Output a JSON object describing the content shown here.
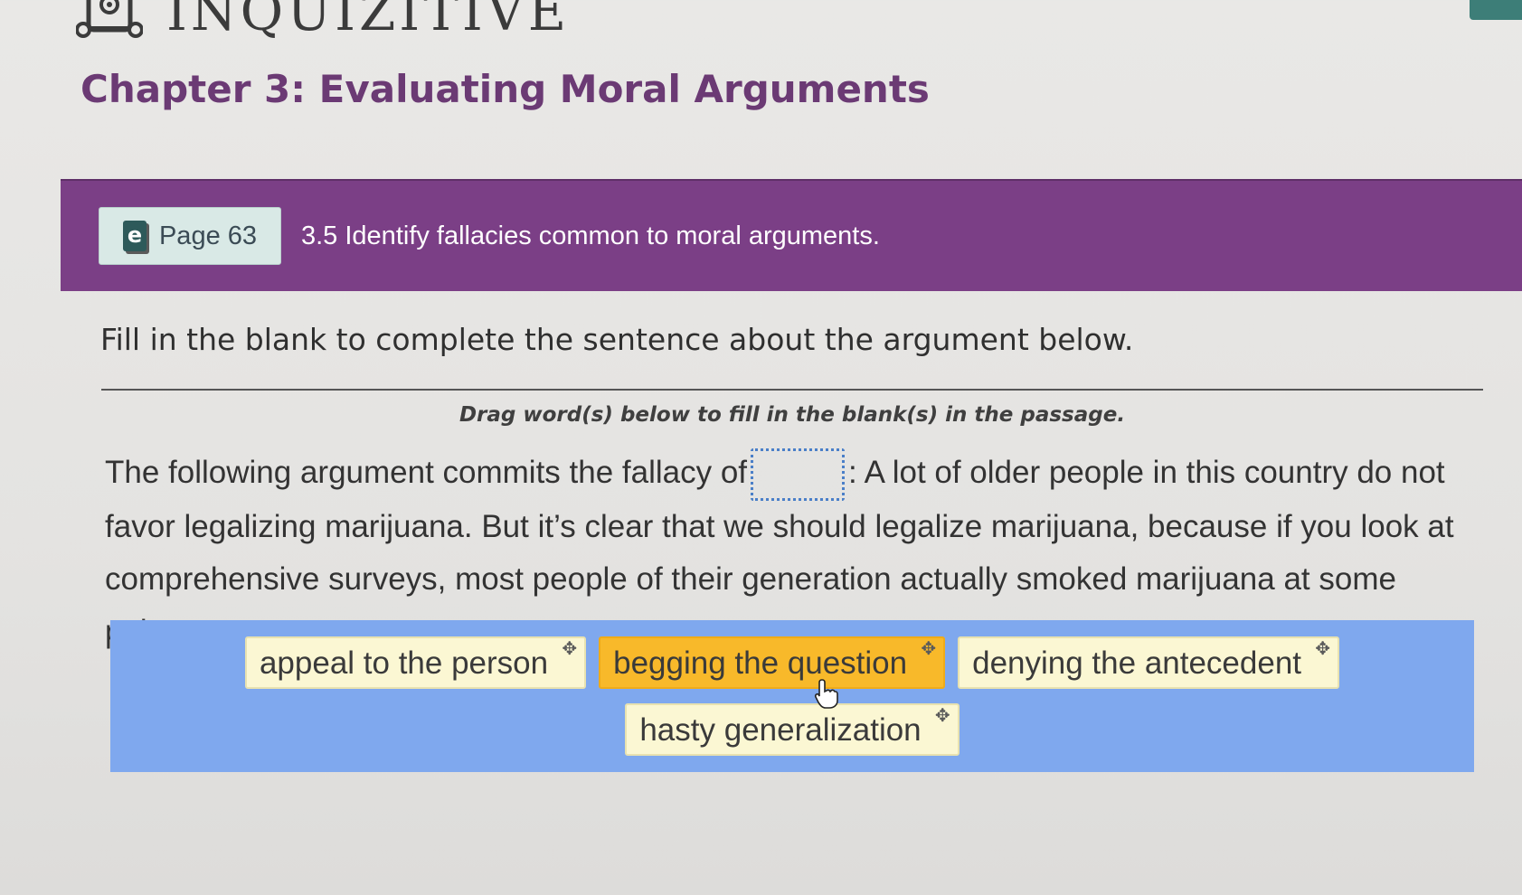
{
  "header": {
    "logo_text": "INQUIZITIVE",
    "chapter_title": "Chapter 3: Evaluating Moral Arguments"
  },
  "banner": {
    "page_label": "Page 63",
    "objective": "3.5 Identify fallacies common to moral arguments.",
    "color": "#7b3f86"
  },
  "question": {
    "instruction": "Fill in the blank to complete the sentence about the argument below.",
    "drag_hint": "Drag word(s) below to fill in the blank(s) in the passage.",
    "passage_before": "The following argument commits the fallacy of",
    "passage_after": ": A lot of older people in this country do not favor legalizing marijuana. But it’s clear that we should legalize marijuana, because if you look at comprehensive surveys, most people of their generation actually smoked marijuana at some point."
  },
  "word_bank": {
    "color": "#7fa8ee",
    "options": [
      {
        "label": "appeal to the person",
        "selected": false
      },
      {
        "label": "begging the question",
        "selected": true
      },
      {
        "label": "denying the antecedent",
        "selected": false
      },
      {
        "label": "hasty generalization",
        "selected": false
      }
    ]
  },
  "icons": {
    "logo": "speaker-mascot-icon",
    "ebook": "ebook-icon",
    "chip_handle": "move-icon",
    "cursor": "hand-pointer-icon"
  }
}
